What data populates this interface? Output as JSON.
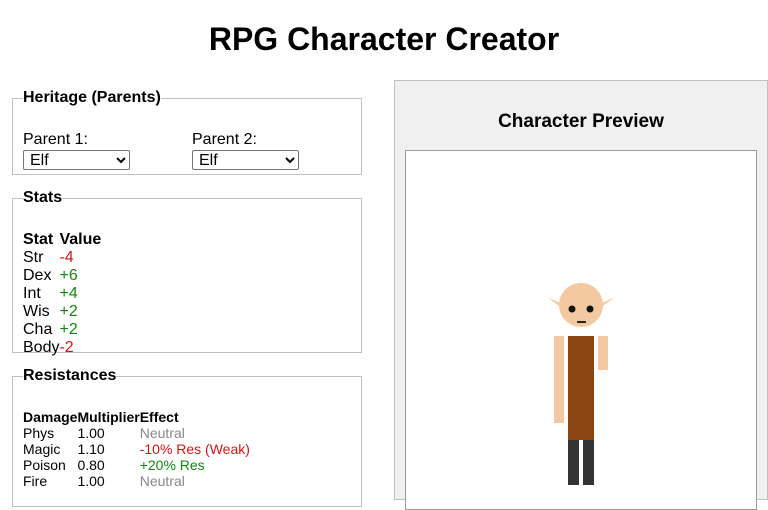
{
  "title": "RPG Character Creator",
  "heritage": {
    "legend": "Heritage (Parents)",
    "parent1_label": "Parent 1:",
    "parent1_value": "Elf",
    "parent2_label": "Parent 2:",
    "parent2_value": "Elf"
  },
  "stats": {
    "legend": "Stats",
    "headers": [
      "Stat",
      "Value"
    ],
    "rows": [
      {
        "stat": "Str",
        "value": "-4",
        "tone": "neg"
      },
      {
        "stat": "Dex",
        "value": "+6",
        "tone": "pos"
      },
      {
        "stat": "Int",
        "value": "+4",
        "tone": "pos"
      },
      {
        "stat": "Wis",
        "value": "+2",
        "tone": "pos"
      },
      {
        "stat": "Cha",
        "value": "+2",
        "tone": "pos"
      },
      {
        "stat": "Body",
        "value": "-2",
        "tone": "neg"
      }
    ]
  },
  "resistances": {
    "legend": "Resistances",
    "headers": [
      "Damage",
      "Multiplier",
      "Effect"
    ],
    "rows": [
      {
        "damage": "Phys",
        "multiplier": "1.00",
        "effect": "Neutral",
        "tone": "neu"
      },
      {
        "damage": "Magic",
        "multiplier": "1.10",
        "effect": "-10% Res (Weak)",
        "tone": "neg"
      },
      {
        "damage": "Poison",
        "multiplier": "0.80",
        "effect": "+20% Res",
        "tone": "pos"
      },
      {
        "damage": "Fire",
        "multiplier": "1.00",
        "effect": "Neutral",
        "tone": "neu"
      }
    ]
  },
  "preview": {
    "title": "Character Preview",
    "skin_color": "#f2c9a0",
    "tunic_color": "#8b4513",
    "pants_color": "#333333"
  },
  "colors": {
    "positive": "#118811",
    "negative": "#dd1111",
    "neutral": "#888888"
  }
}
